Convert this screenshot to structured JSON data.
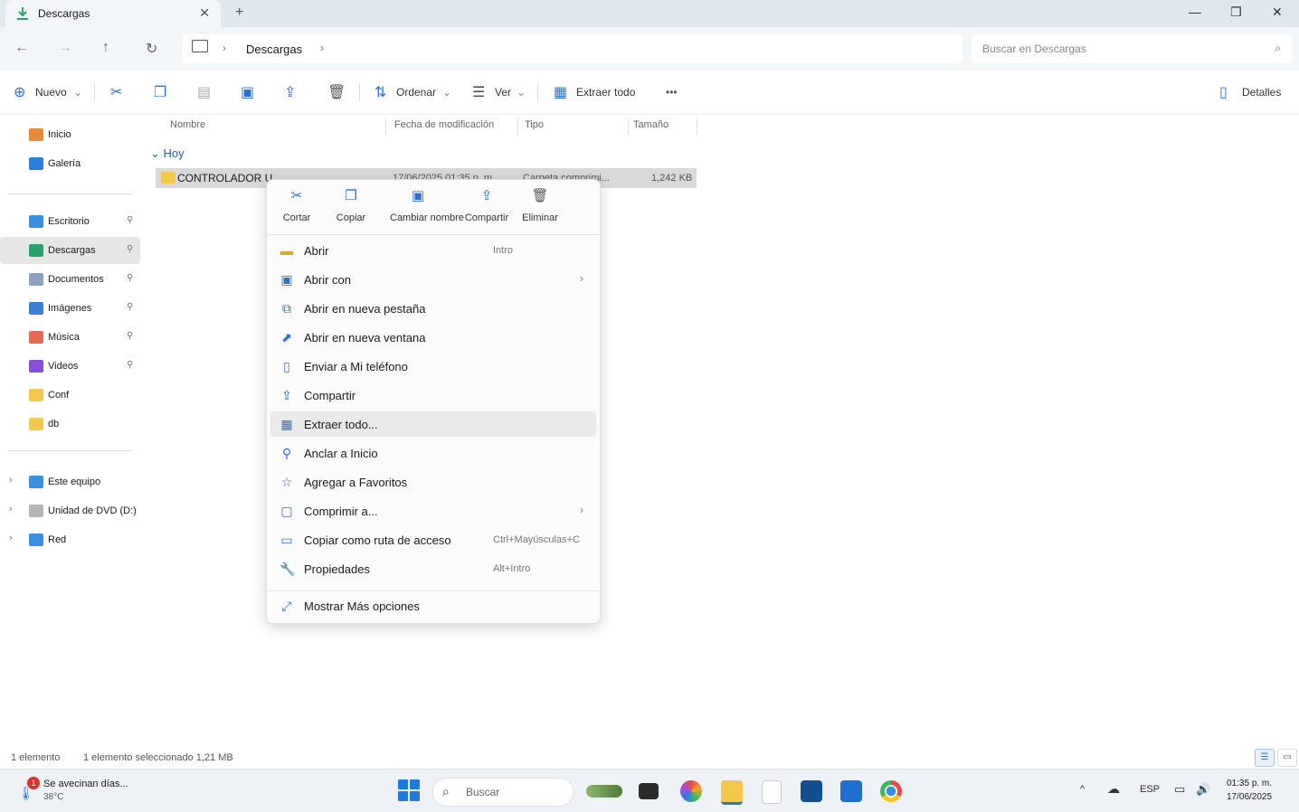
{
  "window": {
    "tab_title": "Descargas",
    "tab_close": "✕",
    "new_tab": "+",
    "minimize": "—",
    "restore": "❐",
    "close": "✕"
  },
  "nav": {
    "back": "←",
    "forward": "→",
    "up": "↑",
    "refresh": "↻",
    "breadcrumb_sep": "›",
    "breadcrumb": "Descargas",
    "search_placeholder": "Buscar en Descargas",
    "search_icon": "⌕"
  },
  "toolbar": {
    "new": "Nuevo",
    "sort": "Ordenar",
    "view": "Ver",
    "extract_all": "Extraer todo",
    "more": "•••",
    "details": "Detalles"
  },
  "sidebar": {
    "items": [
      {
        "label": "Inicio",
        "icon": "home-icon",
        "color": "#e8893a",
        "pinned": false
      },
      {
        "label": "Galería",
        "icon": "gallery-icon",
        "color": "#2b7fd8",
        "pinned": false
      },
      {
        "label": "Escritorio",
        "icon": "desktop-icon",
        "color": "#3b8ee0",
        "pinned": true
      },
      {
        "label": "Descargas",
        "icon": "downloads-icon",
        "color": "#2aa36b",
        "pinned": true,
        "selected": true
      },
      {
        "label": "Documentos",
        "icon": "documents-icon",
        "color": "#8aa3c2",
        "pinned": true
      },
      {
        "label": "Imágenes",
        "icon": "pictures-icon",
        "color": "#3a7fd8",
        "pinned": true
      },
      {
        "label": "Música",
        "icon": "music-icon",
        "color": "#e06a55",
        "pinned": true
      },
      {
        "label": "Videos",
        "icon": "videos-icon",
        "color": "#8a4fd8",
        "pinned": true
      },
      {
        "label": "Conf",
        "icon": "folder-icon",
        "color": "#f2c94c",
        "pinned": false
      },
      {
        "label": "db",
        "icon": "folder-icon",
        "color": "#f2c94c",
        "pinned": false
      }
    ],
    "devices": [
      {
        "label": "Este equipo",
        "icon": "pc-icon",
        "color": "#3b8ee0"
      },
      {
        "label": "Unidad de DVD (D:)",
        "icon": "dvd-icon",
        "color": "#b5b5b5"
      },
      {
        "label": "Red",
        "icon": "network-icon",
        "color": "#3b8ee0"
      }
    ],
    "pin_glyph": "⚲",
    "expand_glyph": "›"
  },
  "columns": [
    "Nombre",
    "Fecha de modificación",
    "Tipo",
    "Tamaño"
  ],
  "group": "Hoy",
  "file": {
    "name": "CONTROLADOR U",
    "date": "17/06/2025 01:35 p. m.",
    "type": "Carpeta comprimi...",
    "size": "1,242 KB"
  },
  "context_menu": {
    "quick_actions": [
      "Cortar",
      "Copiar",
      "Cambiar nombre",
      "Compartir",
      "Eliminar"
    ],
    "items": [
      {
        "label": "Abrir",
        "shortcut": "Intro",
        "icon": "folder-open-icon"
      },
      {
        "label": "Abrir con",
        "shortcut": "",
        "icon": "open-with-icon",
        "submenu": true
      },
      {
        "label": "Abrir en nueva pestaña",
        "shortcut": "",
        "icon": "new-tab-icon"
      },
      {
        "label": "Abrir en nueva ventana",
        "shortcut": "",
        "icon": "new-window-icon"
      },
      {
        "label": "Enviar a Mi teléfono",
        "shortcut": "",
        "icon": "phone-icon"
      },
      {
        "label": "Compartir",
        "shortcut": "",
        "icon": "share-icon"
      },
      {
        "label": "Extraer todo...",
        "shortcut": "",
        "icon": "extract-icon",
        "highlighted": true
      },
      {
        "label": "Anclar a Inicio",
        "shortcut": "",
        "icon": "pin-start-icon"
      },
      {
        "label": "Agregar a Favoritos",
        "shortcut": "",
        "icon": "star-icon"
      },
      {
        "label": "Comprimir a...",
        "shortcut": "",
        "icon": "compress-icon",
        "submenu": true
      },
      {
        "label": "Copiar como ruta de acceso",
        "shortcut": "Ctrl+Mayúsculas+C",
        "icon": "copy-path-icon"
      },
      {
        "label": "Propiedades",
        "shortcut": "Alt+Intro",
        "icon": "wrench-icon"
      }
    ],
    "more_options": "Mostrar Más opciones"
  },
  "status": {
    "count": "1 elemento",
    "selected": "1 elemento seleccionado 1,21 MB"
  },
  "taskbar": {
    "weather_title": "Se avecinan días...",
    "weather_temp": "38°C",
    "weather_badge": "1",
    "search_placeholder": "Buscar",
    "tray_language": "ESP",
    "time": "01:35 p. m.",
    "date": "17/06/2025",
    "chevron": "^"
  }
}
